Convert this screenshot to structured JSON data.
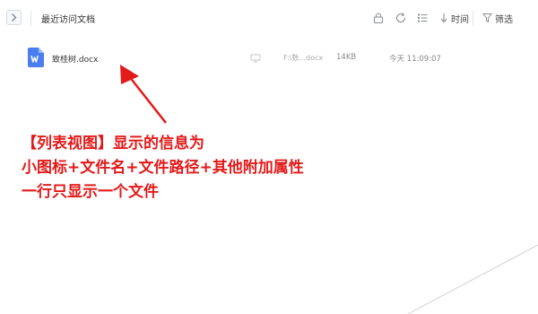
{
  "header": {
    "title": "最近访问文档",
    "sort_label": "时间",
    "filter_label": "筛选"
  },
  "files": [
    {
      "name": "致桂树.docx",
      "path": "F:\\数...docx",
      "size": "14KB",
      "time": "今天 11:09:07"
    }
  ],
  "annotation": {
    "lines": [
      "【列表视图】显示的信息为",
      "小图标+文件名+文件路径+其他附加属性",
      "一行只显示一个文件"
    ]
  },
  "colors": {
    "annotation": "#e31a1a",
    "doc_icon": "#4a7ef0"
  },
  "icons": [
    "chevron-right-icon",
    "lock-icon",
    "refresh-icon",
    "list-icon",
    "sort-down-icon",
    "filter-icon",
    "word-doc-icon",
    "device-icon"
  ]
}
